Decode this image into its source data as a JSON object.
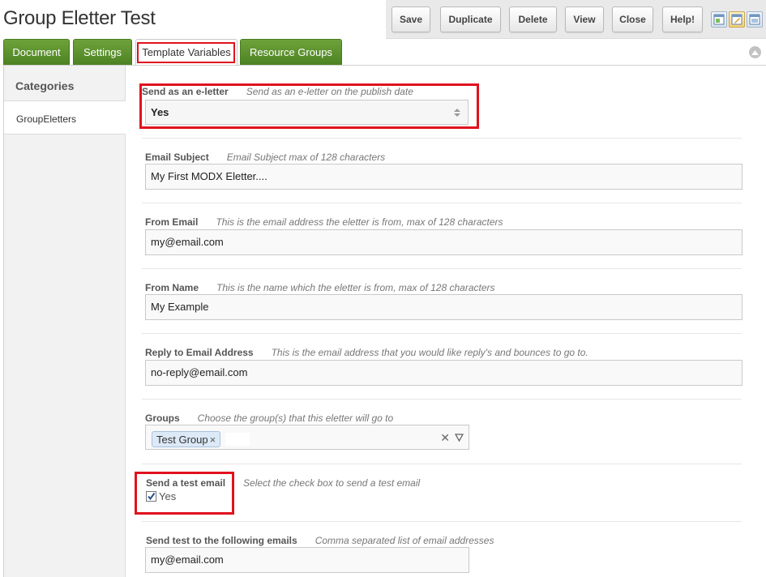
{
  "page": {
    "title": "Group Eletter Test"
  },
  "toolbar": {
    "buttons": [
      "Save",
      "Duplicate",
      "Delete",
      "View",
      "Close",
      "Help!"
    ],
    "view_icons": [
      "layout-icon",
      "edit-layout-icon",
      "full-layout-icon"
    ]
  },
  "tabs": [
    {
      "label": "Document",
      "active": false
    },
    {
      "label": "Settings",
      "active": false
    },
    {
      "label": "Template Variables",
      "active": true
    },
    {
      "label": "Resource Groups",
      "active": false
    }
  ],
  "sidebar": {
    "heading": "Categories",
    "items": [
      "GroupEletters"
    ]
  },
  "fields": {
    "send_eletter": {
      "label": "Send as an e-letter",
      "description": "Send as an e-letter on the publish date",
      "value": "Yes"
    },
    "email_subject": {
      "label": "Email Subject",
      "description": "Email Subject max of 128 characters",
      "value": "My First MODX Eletter...."
    },
    "from_email": {
      "label": "From Email",
      "description": "This is the email address the eletter is from, max of 128 characters",
      "value": "my@email.com"
    },
    "from_name": {
      "label": "From Name",
      "description": "This is the name which the eletter is from, max of 128 characters",
      "value": "My Example"
    },
    "reply_to": {
      "label": "Reply to Email Address",
      "description": "This is the email address that you would like reply's and bounces to go to.",
      "value": "no-reply@email.com"
    },
    "groups": {
      "label": "Groups",
      "description": "Choose the group(s) that this eletter will go to",
      "selected": [
        "Test Group"
      ]
    },
    "send_test": {
      "label": "Send a test email",
      "description": "Select the check box to send a test email",
      "option": "Yes",
      "checked": true
    },
    "test_emails": {
      "label": "Send test to the following emails",
      "description": "Comma separated list of email addresses",
      "value": "my@email.com"
    }
  },
  "colors": {
    "tab_green": "#5b922e",
    "highlight_red": "#e0121e"
  }
}
